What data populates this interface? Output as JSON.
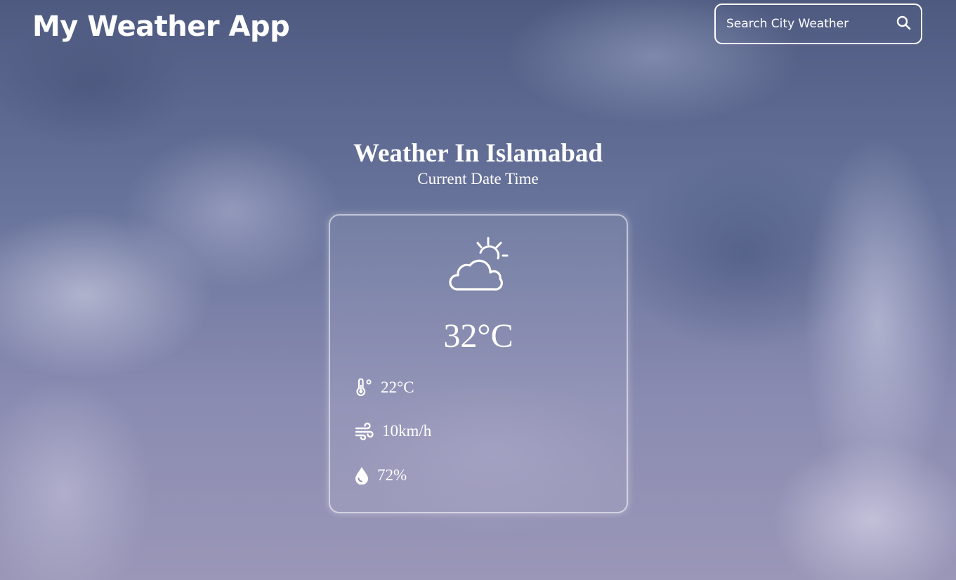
{
  "header": {
    "app_title": "My Weather App",
    "search": {
      "placeholder": "Search City Weather",
      "button_icon": "search-icon"
    }
  },
  "location": {
    "title": "Weather In Islamabad",
    "date_time": "Current Date Time"
  },
  "weather": {
    "condition_icon": "partly-sunny-cloud-icon",
    "temperature": "32°C",
    "details": {
      "feels_like": {
        "icon": "thermometer-icon",
        "value": "22°C"
      },
      "wind": {
        "icon": "wind-icon",
        "value": "10km/h"
      },
      "humidity": {
        "icon": "water-drop-icon",
        "value": "72%"
      }
    }
  },
  "colors": {
    "text": "#ffffff",
    "background": "#67739b"
  }
}
